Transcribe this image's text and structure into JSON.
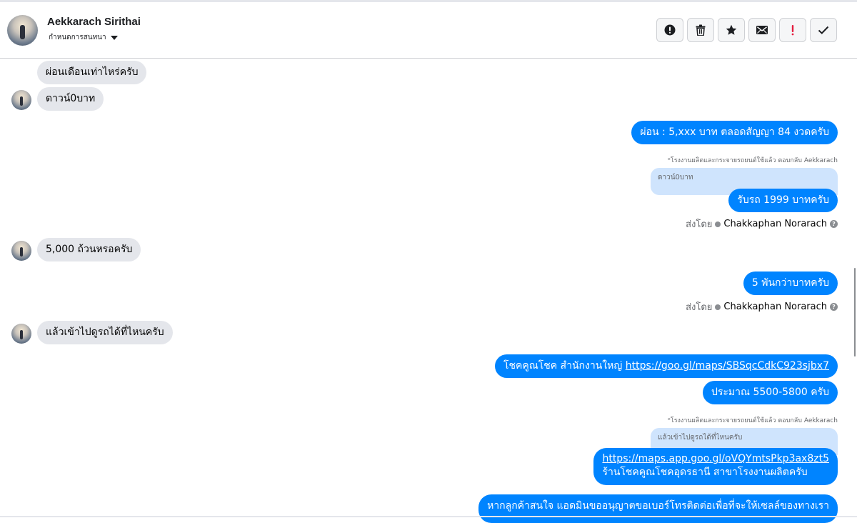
{
  "header": {
    "contact_name": "Aekkarach Sirithai",
    "assign_label": "กำหนดการสนทนา",
    "actions": [
      {
        "icon": "alert-circle-icon",
        "color": "#1c1e21"
      },
      {
        "icon": "trash-icon",
        "color": "#1c1e21"
      },
      {
        "icon": "star-icon",
        "color": "#1c1e21"
      },
      {
        "icon": "envelope-icon",
        "color": "#1c1e21"
      },
      {
        "icon": "exclamation-icon",
        "color": "#e41e3f"
      },
      {
        "icon": "check-icon",
        "color": "#1c1e21"
      }
    ]
  },
  "colors": {
    "outgoing_bubble": "#0084ff",
    "incoming_bubble": "#e4e6eb",
    "quote_bubble": "#cfe4fd"
  },
  "messages": {
    "m1": "ผ่อนเดือนเท่าไหร่ครับ",
    "m2": "ดาวน์0บาท",
    "m3": "ผ่อน : 5,xxx บาท ตลอดสัญญา 84 งวดครับ",
    "reply1_note": "ᵉโรงงานผลิตและกระจายรถยนต์ใช้แล้ว ตอบกลับ Aekkarach",
    "reply1_quote": "ดาวน์0บาท",
    "m4": "รับรถ 1999 บาทครับ",
    "sent_by_label": "ส่งโดย",
    "sender_name": "Chakkaphan Norarach",
    "m5": "5,000 ถ้วนหรอครับ",
    "m6": "5 พันกว่าบาทครับ",
    "m7": "แล้วเข้าไปดูรถได้ที่ไหนครับ",
    "m8_text": "โชคคูณโชค สำนักงานใหญ่ ",
    "m8_link": "https://goo.gl/maps/SBSqcCdkC923sjbx7",
    "m9": "ประมาณ 5500-5800 ครับ",
    "reply2_note": "ᵉโรงงานผลิตและกระจายรถยนต์ใช้แล้ว ตอบกลับ Aekkarach",
    "reply2_quote": "แล้วเข้าไปดูรถได้ที่ไหนครับ",
    "m10_link": "https://maps.app.goo.gl/oVQYmtsPkp3ax8zt5",
    "m10_text": "ร้านโชคคูณโชคอุดรธานี สาขาโรงงานผลิตครับ",
    "m11": "หากลูกค้าสนใจ แอดมินขออนุญาตขอเบอร์โทรติดต่อเพื่อที่จะให้เซลล์ของทางเรา"
  }
}
